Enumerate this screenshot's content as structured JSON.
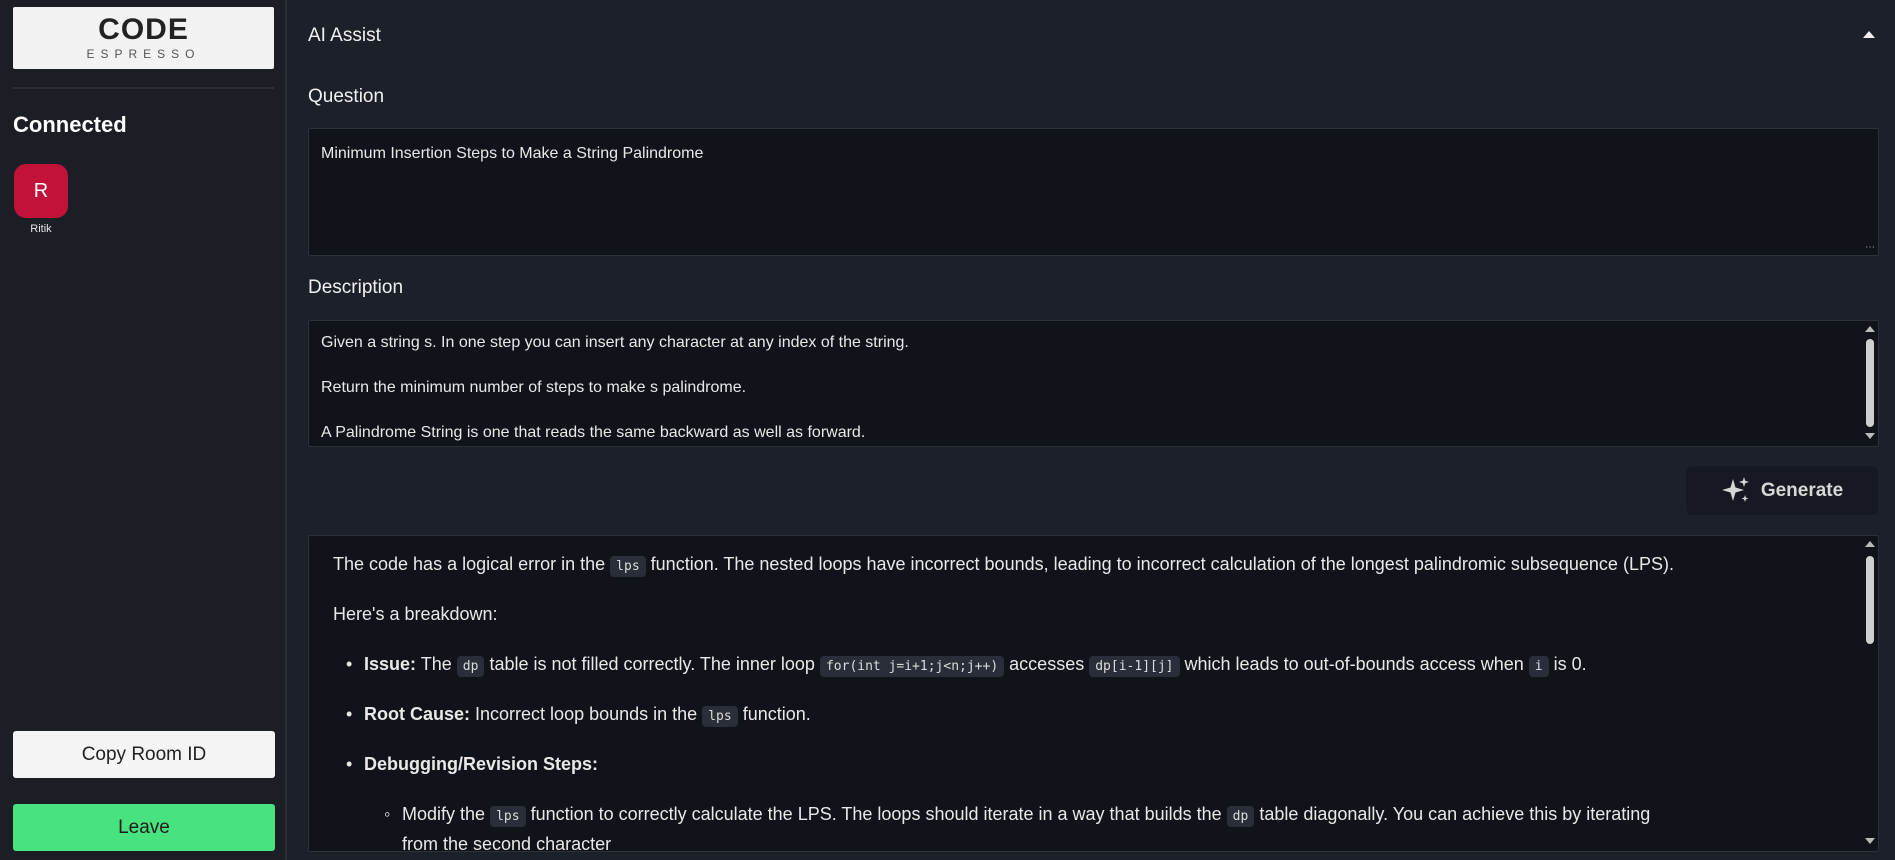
{
  "sidebar": {
    "logo_top": "CODE",
    "logo_bottom": "ESPRESSO",
    "connected_title": "Connected",
    "users": [
      {
        "initial": "R",
        "name": "Ritik",
        "color": "#c3123a"
      }
    ],
    "copy_button": "Copy Room ID",
    "leave_button": "Leave"
  },
  "header": {
    "title": "AI Assist"
  },
  "question": {
    "label": "Question",
    "value": "Minimum Insertion Steps to Make a String Palindrome"
  },
  "description": {
    "label": "Description",
    "lines": [
      "Given a string s. In one step you can insert any character at any index of the string.",
      "Return the minimum number of steps to make s palindrome.",
      "A Palindrome String is one that reads the same backward as well as forward."
    ]
  },
  "generate_button": "Generate",
  "response": {
    "p1_a": "The code has a logical error in the",
    "p1_code": "lps",
    "p1_b": "function. The nested loops have incorrect bounds, leading to incorrect calculation of the longest palindromic subsequence (LPS).",
    "p2": "Here's a breakdown:",
    "issue_label": "Issue:",
    "issue_a": "The",
    "issue_code1": "dp",
    "issue_b": "table is not filled correctly. The inner loop",
    "issue_code2": "for(int j=i+1;j<n;j++)",
    "issue_c": "accesses",
    "issue_code3": "dp[i-1][j]",
    "issue_d": "which leads to out-of-bounds access when",
    "issue_code4": "i",
    "issue_e": "is 0.",
    "root_label": "Root Cause:",
    "root_a": "Incorrect loop bounds in the",
    "root_code": "lps",
    "root_b": "function.",
    "debug_label": "Debugging/Revision Steps:",
    "sub_a": "Modify the",
    "sub_code1": "lps",
    "sub_b": "function to correctly calculate the LPS. The loops should iterate in a way that builds the",
    "sub_code2": "dp",
    "sub_c": "table diagonally. You can achieve this by iterating",
    "sub_line2": "from the second character"
  },
  "colors": {
    "background": "#1c2029",
    "panel": "#10131a",
    "avatar": "#c3123a",
    "leave_button": "#48e27e"
  }
}
